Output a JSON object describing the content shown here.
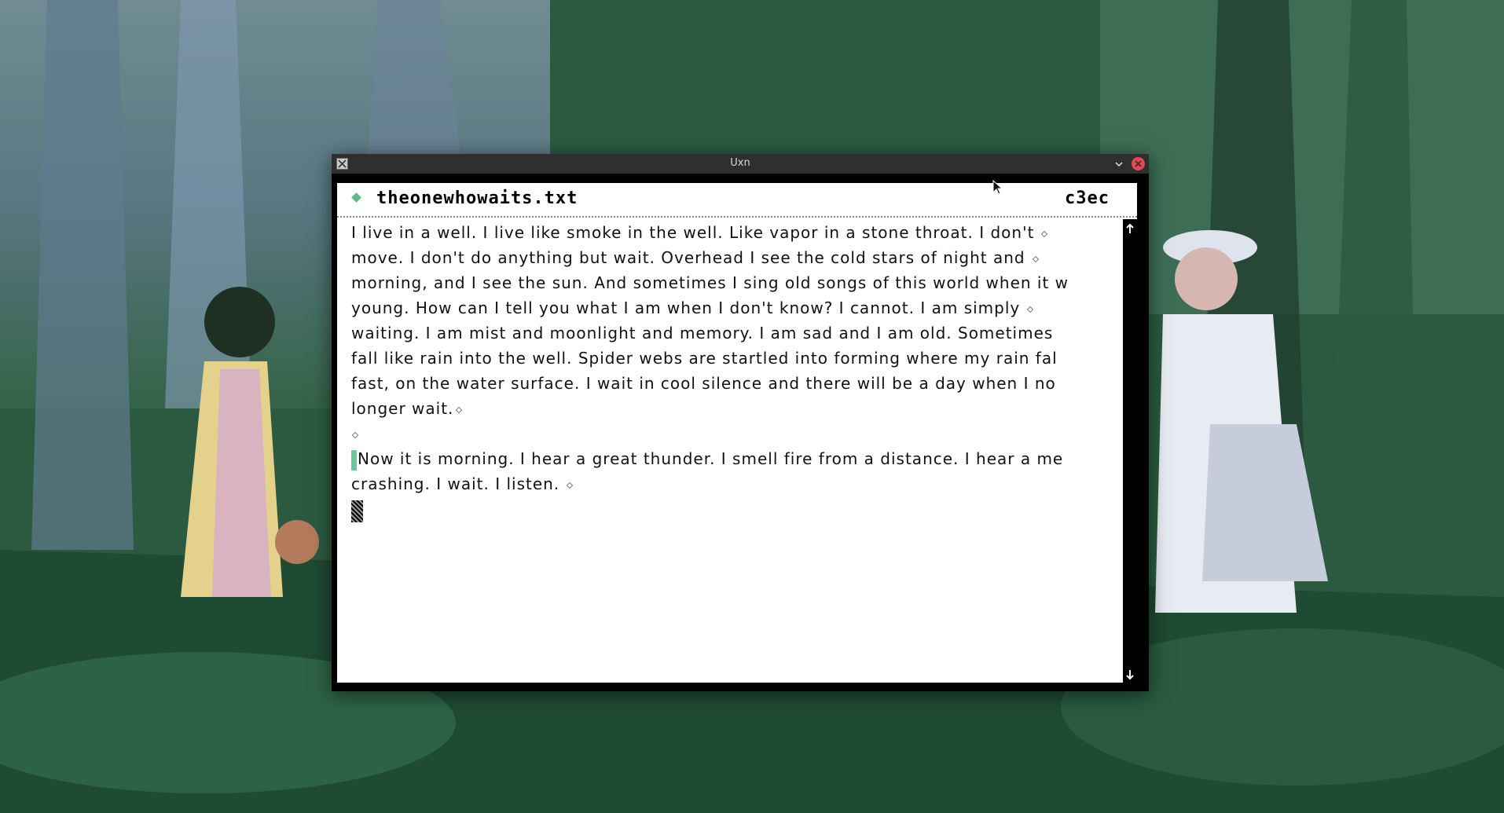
{
  "window": {
    "title": "Uxn"
  },
  "editor": {
    "filename": "theonewhowaits.txt",
    "hash": "c3ec",
    "lines": [
      "I live in a well. I live like smoke in the well. Like vapor in a stone throat. I don't",
      "move. I don't do anything but wait. Overhead I see the cold stars of night and",
      "morning, and I see the sun. And sometimes I sing old songs of this world when it w",
      "young. How can I tell you what I am when I don't know? I cannot. I am simply",
      "waiting. I am mist and moonlight and memory. I am sad and I am old. Sometimes",
      "fall like rain into the well. Spider webs are startled into forming where my rain fal",
      "fast, on the water surface. I wait in cool silence and there will be a day when I no",
      "longer wait.",
      "",
      "Now it is morning. I hear a great thunder. I smell fire from a distance. I hear a me",
      "crashing. I wait. I listen."
    ]
  },
  "colors": {
    "accent": "#5fbb8b",
    "close": "#e04a55",
    "titlebar": "#2f2f30"
  }
}
